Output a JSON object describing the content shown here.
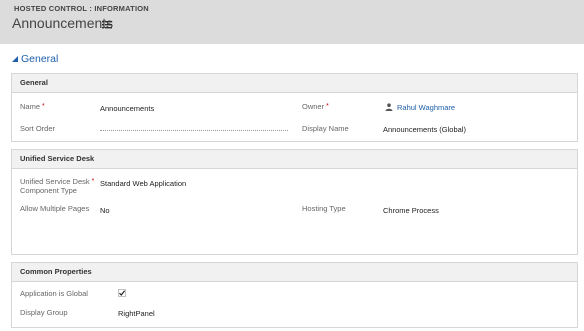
{
  "header": {
    "breadcrumb": "HOSTED CONTROL : INFORMATION",
    "title": "Announcements"
  },
  "section": {
    "label": "General"
  },
  "panels": {
    "general": {
      "title": "General",
      "name_label": "Name",
      "name_value": "Announcements",
      "sort_order_label": "Sort Order",
      "sort_order_value": "",
      "owner_label": "Owner",
      "owner_value": "Rahul Waghmare",
      "display_name_label": "Display Name",
      "display_name_value": "Announcements (Global)"
    },
    "usd": {
      "title": "Unified Service Desk",
      "component_type_label_1": "Unified Service Desk",
      "component_type_label_2": "Component Type",
      "component_type_value": "Standard Web Application",
      "allow_multiple_label": "Allow Multiple Pages",
      "allow_multiple_value": "No",
      "hosting_type_label": "Hosting Type",
      "hosting_type_value": "Chrome Process"
    },
    "common": {
      "title": "Common Properties",
      "global_label": "Application is Global",
      "global_checked": true,
      "display_group_label": "Display Group",
      "display_group_value": "RightPanel"
    }
  },
  "required_mark": "*",
  "colors": {
    "header_bg": "#dcdcdc",
    "link": "#1e5fa8",
    "required": "#cc0000"
  }
}
